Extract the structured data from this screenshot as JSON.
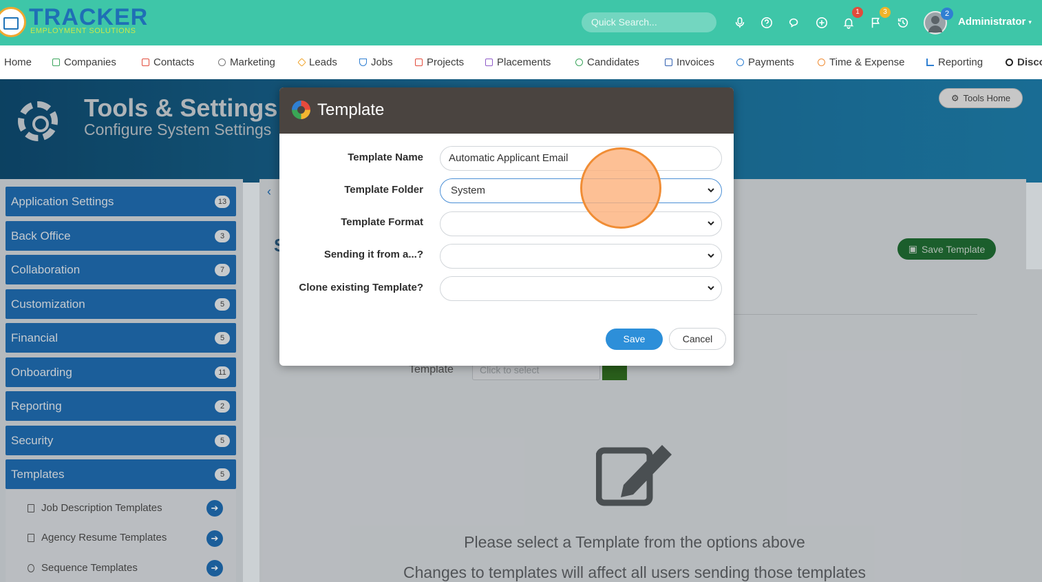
{
  "brand": {
    "name": "TRACKER",
    "tagline": "EMPLOYMENT SOLUTIONS"
  },
  "header": {
    "search_placeholder": "Quick Search...",
    "badges": {
      "notifications": "1",
      "flags": "3",
      "avatar": "2"
    },
    "user_name": "Administrator",
    "colors": {
      "topbar": "#3ec6a8",
      "badge_red": "#e24b3b",
      "badge_yellow": "#f0b429",
      "badge_blue": "#2f7fd2"
    }
  },
  "nav": {
    "items": [
      {
        "label": "Home",
        "icon": "none",
        "color": "#3d3d3d"
      },
      {
        "label": "Companies",
        "icon": "building-icon",
        "color": "#3ba55c"
      },
      {
        "label": "Contacts",
        "icon": "contact-icon",
        "color": "#e24b3b"
      },
      {
        "label": "Marketing",
        "icon": "broadcast-icon",
        "color": "#777777"
      },
      {
        "label": "Leads",
        "icon": "diamond-icon",
        "color": "#f0a32a"
      },
      {
        "label": "Jobs",
        "icon": "trophy-icon",
        "color": "#2f7fd2"
      },
      {
        "label": "Projects",
        "icon": "checkbox-icon",
        "color": "#e24b3b"
      },
      {
        "label": "Placements",
        "icon": "briefcase-icon",
        "color": "#8e5ac8"
      },
      {
        "label": "Candidates",
        "icon": "person-icon",
        "color": "#3ba55c"
      },
      {
        "label": "Invoices",
        "icon": "document-icon",
        "color": "#2f5fb0"
      },
      {
        "label": "Payments",
        "icon": "coins-icon",
        "color": "#2f7fd2"
      },
      {
        "label": "Time & Expense",
        "icon": "clock-icon",
        "color": "#f08d35"
      },
      {
        "label": "Reporting",
        "icon": "bar-chart-icon",
        "color": "#2f7fd2"
      },
      {
        "label": "Disco",
        "icon": "search-icon",
        "color": "#222222"
      }
    ]
  },
  "banner": {
    "title": "Tools & Settings",
    "subtitle": "Configure System Settings",
    "tools_home": "Tools Home"
  },
  "sidebar": {
    "items": [
      {
        "label": "Application Settings",
        "count": "13"
      },
      {
        "label": "Back Office",
        "count": "3"
      },
      {
        "label": "Collaboration",
        "count": "7"
      },
      {
        "label": "Customization",
        "count": "5"
      },
      {
        "label": "Financial",
        "count": "5"
      },
      {
        "label": "Onboarding",
        "count": "11"
      },
      {
        "label": "Reporting",
        "count": "2"
      },
      {
        "label": "Security",
        "count": "5"
      },
      {
        "label": "Templates",
        "count": "5"
      }
    ],
    "sub_items": [
      {
        "label": "Job Description Templates"
      },
      {
        "label": "Agency Resume Templates"
      },
      {
        "label": "Sequence Templates"
      }
    ]
  },
  "content": {
    "save_template": "Save Template",
    "template_label": "Template",
    "template_select_placeholder": "Click to select",
    "message_1": "Please select a Template from the options above",
    "message_2": "Changes to templates will affect all users sending those templates"
  },
  "modal": {
    "title": "Template",
    "fields": {
      "template_name": {
        "label": "Template Name",
        "value": "Automatic Applicant Email"
      },
      "template_folder": {
        "label": "Template Folder",
        "value": "System"
      },
      "template_format": {
        "label": "Template Format",
        "value": ""
      },
      "sending_from": {
        "label": "Sending it from a...?",
        "value": ""
      },
      "clone_existing": {
        "label": "Clone existing Template?",
        "value": ""
      }
    },
    "save_label": "Save",
    "cancel_label": "Cancel"
  }
}
